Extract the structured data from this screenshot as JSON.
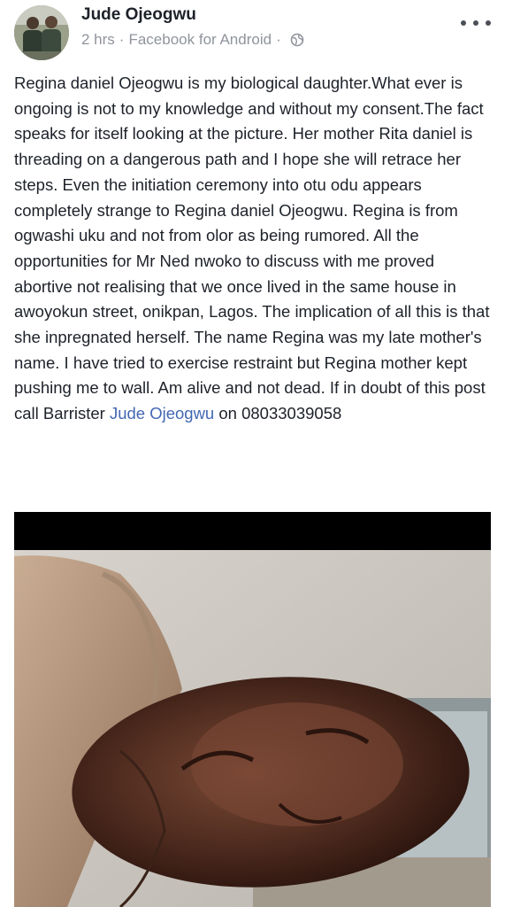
{
  "post": {
    "author": "Jude Ojeogwu",
    "meta": {
      "time": "2 hrs",
      "separator": "·",
      "source": "Facebook for Android",
      "privacy_icon": "globe-icon"
    },
    "more_icon": "more-options-icon",
    "text_before_mention": "Regina daniel Ojeogwu is my biological daughter.What ever is ongoing is not to my knowledge and without my consent.The fact speaks for itself looking at the picture. Her mother Rita daniel is threading on a dangerous path and I hope she will retrace her steps. Even the initiation ceremony into otu odu appears completely strange to Regina daniel Ojeogwu. Regina is from ogwashi uku and not from olor as being rumored. All the opportunities for Mr Ned nwoko to discuss with me proved abortive not realising that we once lived in the same house in awoyokun street, onikpan, Lagos. The implication of all this is that she inpregnated herself. The name Regina was my late mother's name. I have tried to exercise restraint but Regina mother kept pushing me to wall. Am alive and not dead. If in doubt of this post call Barrister ",
    "mention": "Jude Ojeogwu",
    "text_after_mention": " on 08033039058"
  },
  "colors": {
    "text": "#1d2129",
    "meta": "#90949c",
    "link": "#4267b2",
    "photo_top_bar": "#000000"
  }
}
